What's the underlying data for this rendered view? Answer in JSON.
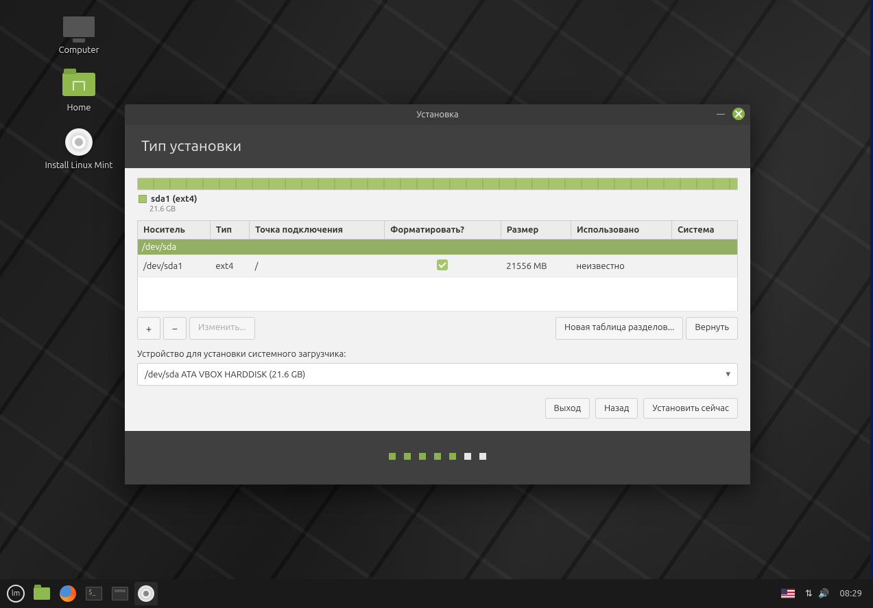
{
  "desktop": {
    "icons": [
      {
        "label": "Computer"
      },
      {
        "label": "Home"
      },
      {
        "label": "Install Linux Mint"
      }
    ]
  },
  "window": {
    "title": "Установка",
    "heading": "Тип установки",
    "partition_summary": {
      "name": "sda1 (ext4)",
      "size": "21.6 GB"
    },
    "columns": {
      "device": "Носитель",
      "type": "Тип",
      "mount": "Точка подключения",
      "format": "Форматировать?",
      "size": "Размер",
      "used": "Использовано",
      "system": "Система"
    },
    "rows": {
      "disk": "/dev/sda",
      "part": {
        "device": "/dev/sda1",
        "type": "ext4",
        "mount": "/",
        "size": "21556 MB",
        "used": "неизвестно",
        "system": ""
      }
    },
    "buttons": {
      "add": "+",
      "remove": "−",
      "change": "Изменить...",
      "new_table": "Новая таблица разделов...",
      "revert": "Вернуть",
      "quit": "Выход",
      "back": "Назад",
      "install": "Установить сейчас"
    },
    "bootloader_label": "Устройство для установки системного загрузчика:",
    "bootloader_value": "/dev/sda   ATA VBOX HARDDISK (21.6 GB)"
  },
  "taskbar": {
    "lang": "US",
    "time": "08:29"
  }
}
